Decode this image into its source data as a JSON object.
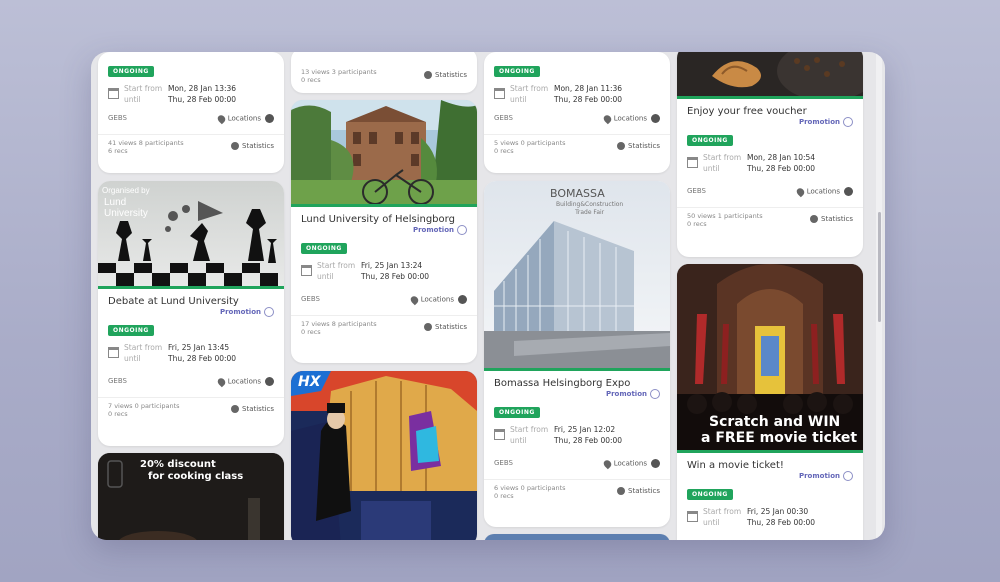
{
  "labels": {
    "badge": "ONGOING",
    "start_from": "Start from",
    "until": "until",
    "promotion": "Promotion",
    "locations": "Locations",
    "statistics": "Statistics",
    "org": "GEBS"
  },
  "col1": {
    "card1": {
      "start": "Mon, 28 Jan 13:36",
      "end": "Thu, 28 Feb 00:00",
      "views": "41 views 8 participants",
      "recs": "6 recs"
    },
    "card2": {
      "image_text": "Organised by\nLund\nUniversity",
      "title": "Debate at Lund University",
      "start": "Fri, 25 Jan 13:45",
      "end": "Thu, 28 Feb 00:00",
      "views": "7 views 0 participants",
      "recs": "0 recs"
    },
    "card3": {
      "image_line1": "20% discount",
      "image_line2": "for cooking class"
    }
  },
  "col2": {
    "card1": {
      "views": "13 views 3 participants",
      "recs": "0 recs"
    },
    "card2": {
      "title": "Lund University of Helsingborg",
      "start": "Fri, 25 Jan 13:24",
      "end": "Thu, 28 Feb 00:00",
      "views": "17 views 8 participants",
      "recs": "0 recs"
    },
    "card3": {
      "image_text": "HX"
    }
  },
  "col3": {
    "card1": {
      "start": "Mon, 28 Jan 11:36",
      "end": "Thu, 28 Feb 00:00",
      "views": "5 views 0 participants",
      "recs": "0 recs"
    },
    "card2": {
      "image_title": "BOMASSA",
      "image_sub": "Building&Construction\nTrade Fair",
      "title": "Bomassa Helsingborg Expo",
      "start": "Fri, 25 Jan 12:02",
      "end": "Thu, 28 Feb 00:00",
      "views": "6 views 0 participants",
      "recs": "0 recs"
    }
  },
  "col4": {
    "card1": {
      "title": "Enjoy your free voucher",
      "start": "Mon, 28 Jan 10:54",
      "end": "Thu, 28 Feb 00:00",
      "views": "50 views 1 participants",
      "recs": "0 recs"
    },
    "card2": {
      "image_line1": "Scratch and WIN",
      "image_line2": "a FREE movie ticket",
      "title": "Win a movie ticket!",
      "start": "Fri, 25 Jan 00:30",
      "end": "Thu, 28 Feb 00:00"
    }
  }
}
